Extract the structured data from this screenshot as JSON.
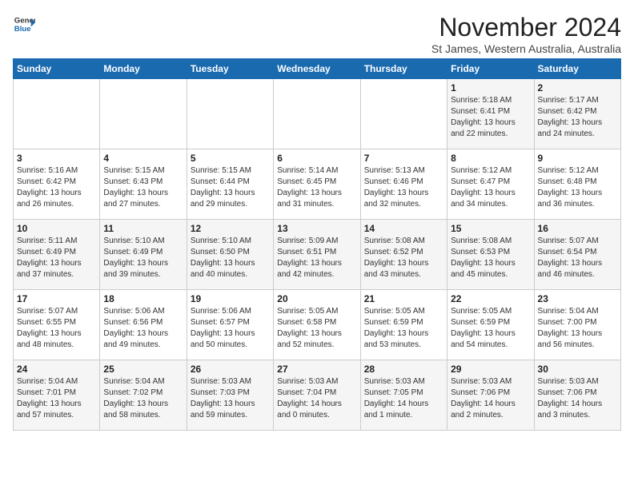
{
  "header": {
    "logo_line1": "General",
    "logo_line2": "Blue",
    "month": "November 2024",
    "location": "St James, Western Australia, Australia"
  },
  "weekdays": [
    "Sunday",
    "Monday",
    "Tuesday",
    "Wednesday",
    "Thursday",
    "Friday",
    "Saturday"
  ],
  "weeks": [
    [
      {
        "day": "",
        "info": ""
      },
      {
        "day": "",
        "info": ""
      },
      {
        "day": "",
        "info": ""
      },
      {
        "day": "",
        "info": ""
      },
      {
        "day": "",
        "info": ""
      },
      {
        "day": "1",
        "info": "Sunrise: 5:18 AM\nSunset: 6:41 PM\nDaylight: 13 hours\nand 22 minutes."
      },
      {
        "day": "2",
        "info": "Sunrise: 5:17 AM\nSunset: 6:42 PM\nDaylight: 13 hours\nand 24 minutes."
      }
    ],
    [
      {
        "day": "3",
        "info": "Sunrise: 5:16 AM\nSunset: 6:42 PM\nDaylight: 13 hours\nand 26 minutes."
      },
      {
        "day": "4",
        "info": "Sunrise: 5:15 AM\nSunset: 6:43 PM\nDaylight: 13 hours\nand 27 minutes."
      },
      {
        "day": "5",
        "info": "Sunrise: 5:15 AM\nSunset: 6:44 PM\nDaylight: 13 hours\nand 29 minutes."
      },
      {
        "day": "6",
        "info": "Sunrise: 5:14 AM\nSunset: 6:45 PM\nDaylight: 13 hours\nand 31 minutes."
      },
      {
        "day": "7",
        "info": "Sunrise: 5:13 AM\nSunset: 6:46 PM\nDaylight: 13 hours\nand 32 minutes."
      },
      {
        "day": "8",
        "info": "Sunrise: 5:12 AM\nSunset: 6:47 PM\nDaylight: 13 hours\nand 34 minutes."
      },
      {
        "day": "9",
        "info": "Sunrise: 5:12 AM\nSunset: 6:48 PM\nDaylight: 13 hours\nand 36 minutes."
      }
    ],
    [
      {
        "day": "10",
        "info": "Sunrise: 5:11 AM\nSunset: 6:49 PM\nDaylight: 13 hours\nand 37 minutes."
      },
      {
        "day": "11",
        "info": "Sunrise: 5:10 AM\nSunset: 6:49 PM\nDaylight: 13 hours\nand 39 minutes."
      },
      {
        "day": "12",
        "info": "Sunrise: 5:10 AM\nSunset: 6:50 PM\nDaylight: 13 hours\nand 40 minutes."
      },
      {
        "day": "13",
        "info": "Sunrise: 5:09 AM\nSunset: 6:51 PM\nDaylight: 13 hours\nand 42 minutes."
      },
      {
        "day": "14",
        "info": "Sunrise: 5:08 AM\nSunset: 6:52 PM\nDaylight: 13 hours\nand 43 minutes."
      },
      {
        "day": "15",
        "info": "Sunrise: 5:08 AM\nSunset: 6:53 PM\nDaylight: 13 hours\nand 45 minutes."
      },
      {
        "day": "16",
        "info": "Sunrise: 5:07 AM\nSunset: 6:54 PM\nDaylight: 13 hours\nand 46 minutes."
      }
    ],
    [
      {
        "day": "17",
        "info": "Sunrise: 5:07 AM\nSunset: 6:55 PM\nDaylight: 13 hours\nand 48 minutes."
      },
      {
        "day": "18",
        "info": "Sunrise: 5:06 AM\nSunset: 6:56 PM\nDaylight: 13 hours\nand 49 minutes."
      },
      {
        "day": "19",
        "info": "Sunrise: 5:06 AM\nSunset: 6:57 PM\nDaylight: 13 hours\nand 50 minutes."
      },
      {
        "day": "20",
        "info": "Sunrise: 5:05 AM\nSunset: 6:58 PM\nDaylight: 13 hours\nand 52 minutes."
      },
      {
        "day": "21",
        "info": "Sunrise: 5:05 AM\nSunset: 6:59 PM\nDaylight: 13 hours\nand 53 minutes."
      },
      {
        "day": "22",
        "info": "Sunrise: 5:05 AM\nSunset: 6:59 PM\nDaylight: 13 hours\nand 54 minutes."
      },
      {
        "day": "23",
        "info": "Sunrise: 5:04 AM\nSunset: 7:00 PM\nDaylight: 13 hours\nand 56 minutes."
      }
    ],
    [
      {
        "day": "24",
        "info": "Sunrise: 5:04 AM\nSunset: 7:01 PM\nDaylight: 13 hours\nand 57 minutes."
      },
      {
        "day": "25",
        "info": "Sunrise: 5:04 AM\nSunset: 7:02 PM\nDaylight: 13 hours\nand 58 minutes."
      },
      {
        "day": "26",
        "info": "Sunrise: 5:03 AM\nSunset: 7:03 PM\nDaylight: 13 hours\nand 59 minutes."
      },
      {
        "day": "27",
        "info": "Sunrise: 5:03 AM\nSunset: 7:04 PM\nDaylight: 14 hours\nand 0 minutes."
      },
      {
        "day": "28",
        "info": "Sunrise: 5:03 AM\nSunset: 7:05 PM\nDaylight: 14 hours\nand 1 minute."
      },
      {
        "day": "29",
        "info": "Sunrise: 5:03 AM\nSunset: 7:06 PM\nDaylight: 14 hours\nand 2 minutes."
      },
      {
        "day": "30",
        "info": "Sunrise: 5:03 AM\nSunset: 7:06 PM\nDaylight: 14 hours\nand 3 minutes."
      }
    ]
  ]
}
